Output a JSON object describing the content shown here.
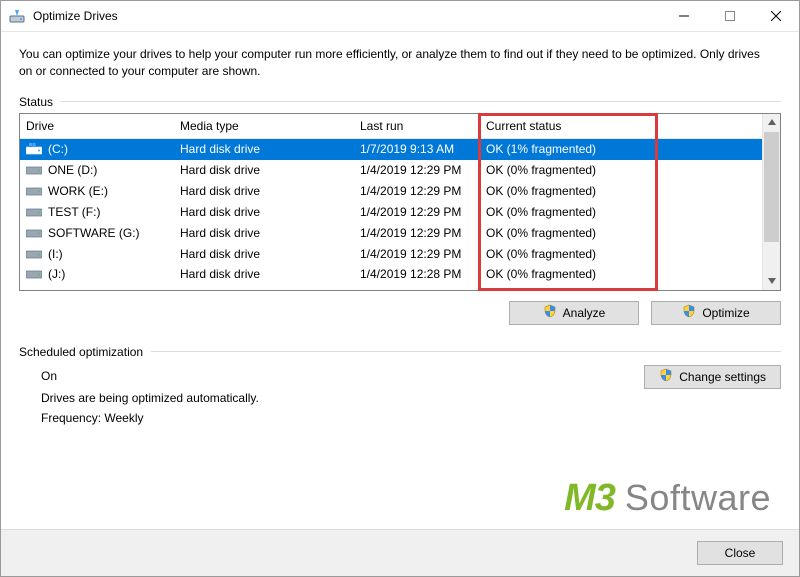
{
  "window": {
    "title": "Optimize Drives"
  },
  "intro": "You can optimize your drives to help your computer run more efficiently, or analyze them to find out if they need to be optimized. Only drives on or connected to your computer are shown.",
  "status_label": "Status",
  "columns": {
    "drive": "Drive",
    "media": "Media type",
    "last": "Last run",
    "status": "Current status"
  },
  "drives": [
    {
      "name": "(C:)",
      "media": "Hard disk drive",
      "last": "1/7/2019 9:13 AM",
      "status": "OK (1% fragmented)",
      "selected": true,
      "icon": "os"
    },
    {
      "name": "ONE (D:)",
      "media": "Hard disk drive",
      "last": "1/4/2019 12:29 PM",
      "status": "OK (0% fragmented)",
      "selected": false,
      "icon": "data"
    },
    {
      "name": "WORK (E:)",
      "media": "Hard disk drive",
      "last": "1/4/2019 12:29 PM",
      "status": "OK (0% fragmented)",
      "selected": false,
      "icon": "data"
    },
    {
      "name": "TEST (F:)",
      "media": "Hard disk drive",
      "last": "1/4/2019 12:29 PM",
      "status": "OK (0% fragmented)",
      "selected": false,
      "icon": "data"
    },
    {
      "name": "SOFTWARE (G:)",
      "media": "Hard disk drive",
      "last": "1/4/2019 12:29 PM",
      "status": "OK (0% fragmented)",
      "selected": false,
      "icon": "data"
    },
    {
      "name": "(I:)",
      "media": "Hard disk drive",
      "last": "1/4/2019 12:29 PM",
      "status": "OK (0% fragmented)",
      "selected": false,
      "icon": "data"
    },
    {
      "name": "(J:)",
      "media": "Hard disk drive",
      "last": "1/4/2019 12:28 PM",
      "status": "OK (0% fragmented)",
      "selected": false,
      "icon": "data"
    }
  ],
  "buttons": {
    "analyze": "Analyze",
    "optimize": "Optimize",
    "change": "Change settings",
    "close": "Close"
  },
  "schedule": {
    "label": "Scheduled optimization",
    "state": "On",
    "line1": "Drives are being optimized automatically.",
    "line2": "Frequency: Weekly"
  },
  "watermark": {
    "m3": "M3",
    "soft": "Software"
  }
}
